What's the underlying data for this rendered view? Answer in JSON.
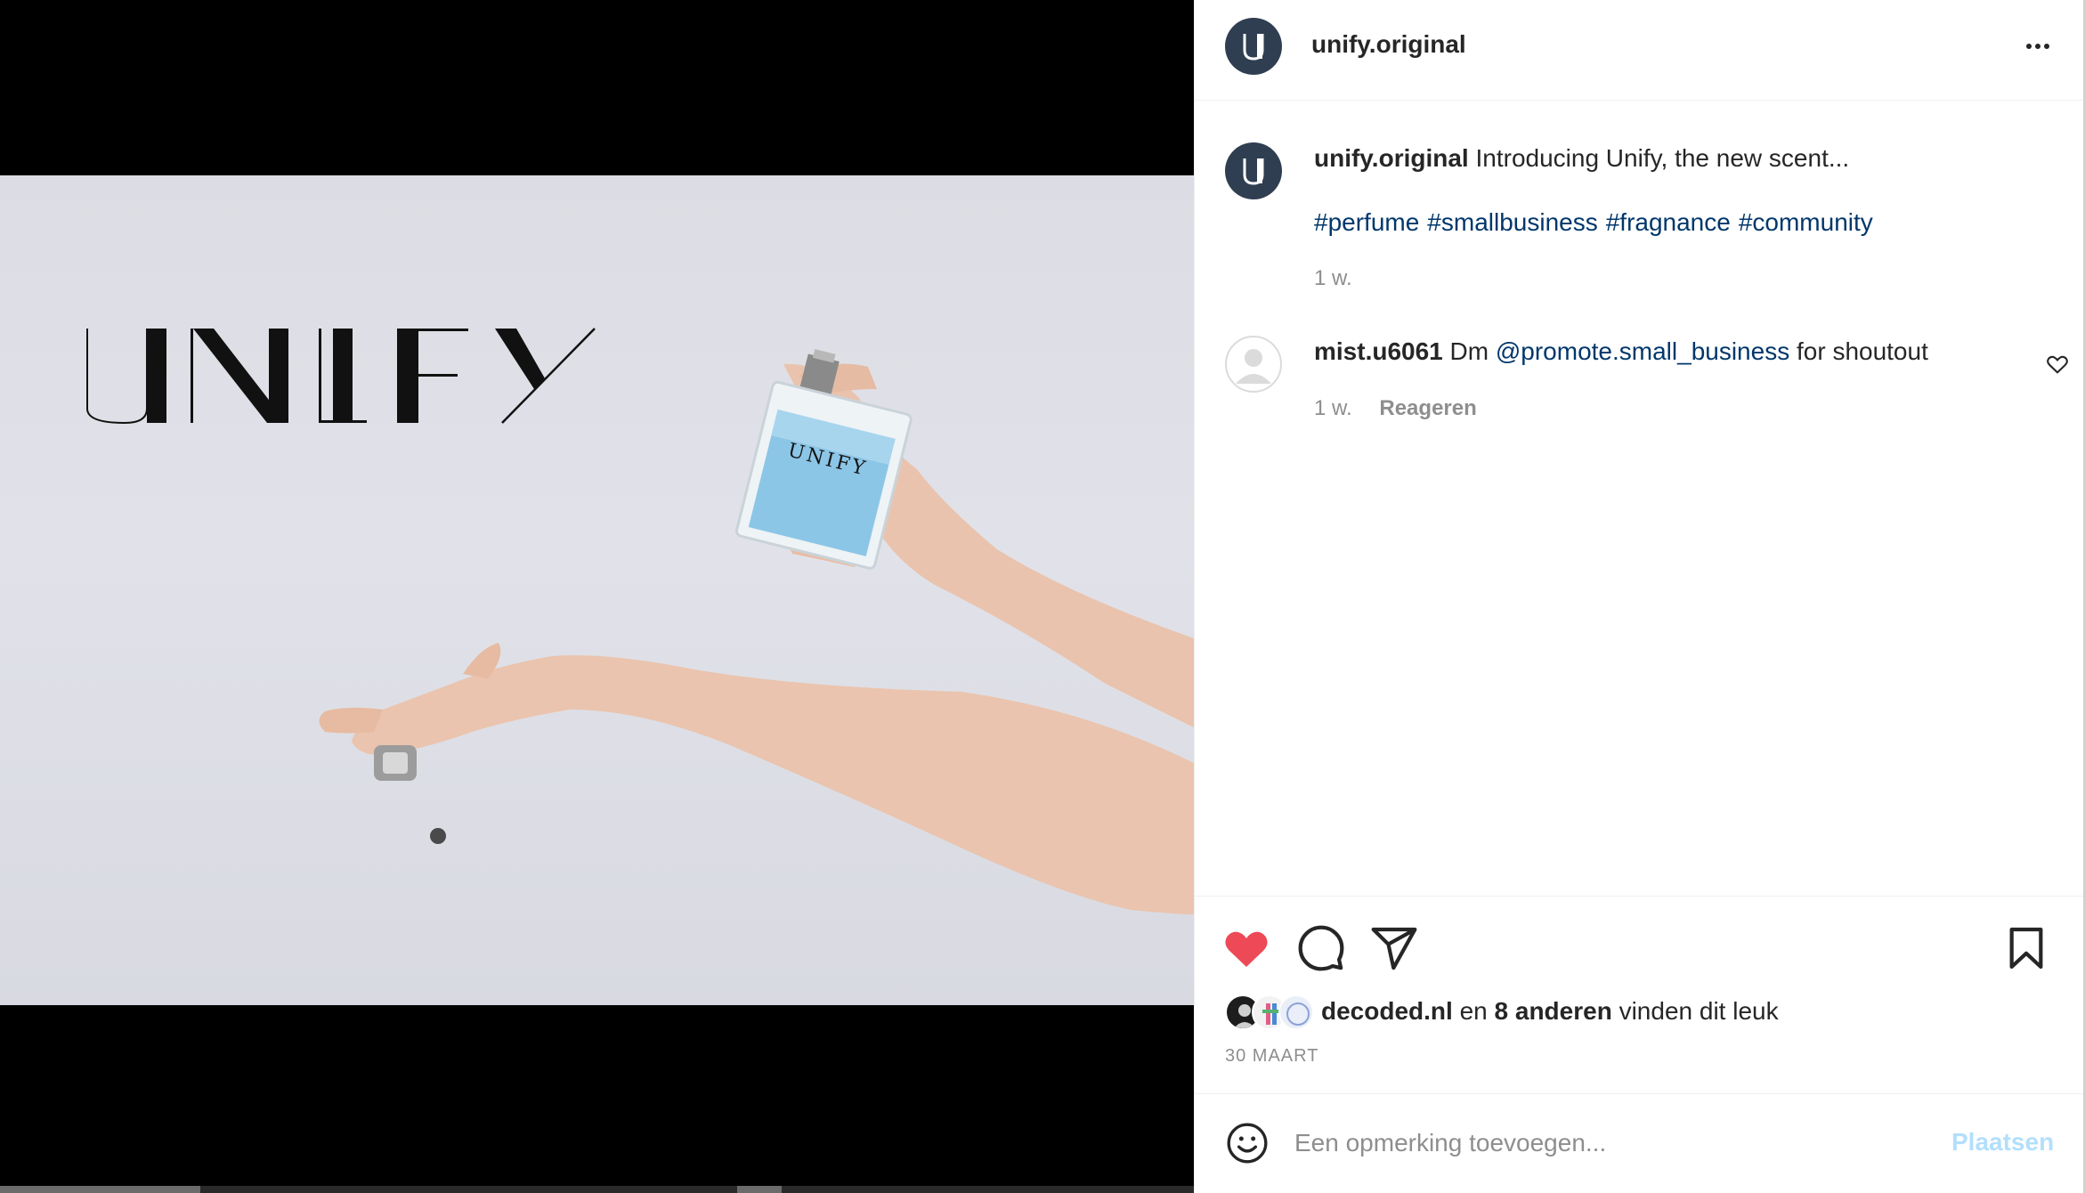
{
  "post": {
    "username": "unify.original",
    "more_icon": "more-horizontal-icon",
    "media": {
      "brand_text": "UNIFY",
      "bottle_label": "UNIFY"
    },
    "caption": {
      "username": "unify.original",
      "text": "Introducing Unify, the new scent...",
      "hashtags": [
        "#perfume",
        "#smallbusiness",
        "#fragnance",
        "#community"
      ],
      "time": "1 w."
    },
    "comments": [
      {
        "username": "mist.u6061",
        "text_before": "Dm",
        "mention": "@promote.small_business",
        "text_after": "for shoutout",
        "time": "1 w.",
        "reply_label": "Reageren"
      }
    ],
    "actions": {
      "like_icon": "heart-filled-icon",
      "comment_icon": "comment-icon",
      "share_icon": "send-icon",
      "save_icon": "bookmark-icon",
      "like_color": "#ed4956"
    },
    "likes": {
      "first_liker": "decoded.nl",
      "connector": "en",
      "others": "8 anderen",
      "suffix": "vinden dit leuk"
    },
    "date": "30 MAART",
    "composer": {
      "placeholder": "Een opmerking toevoegen...",
      "post_label": "Plaatsen"
    }
  }
}
